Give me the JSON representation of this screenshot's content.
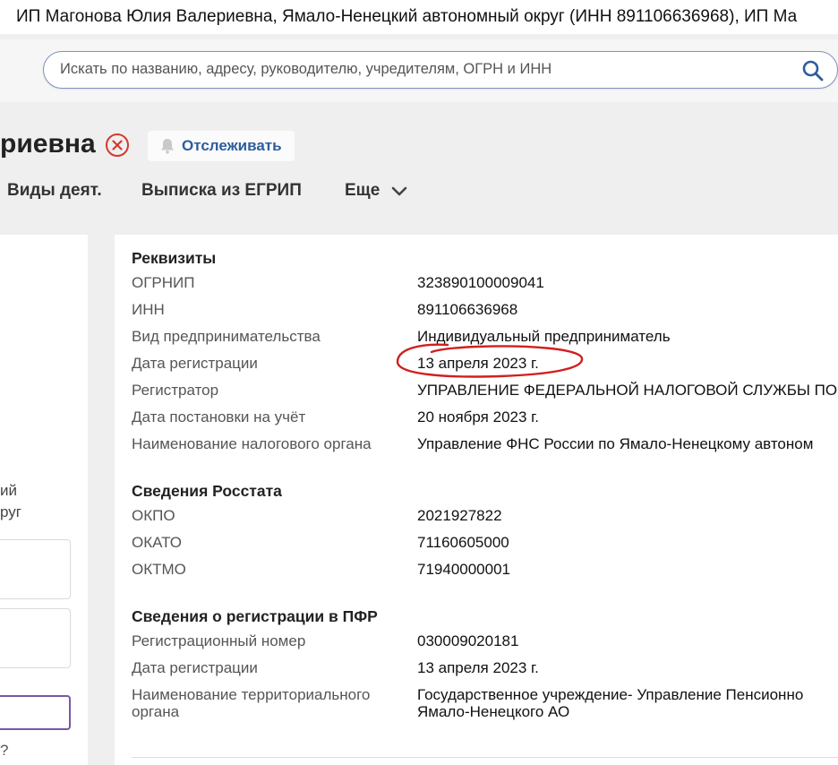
{
  "window": {
    "title": "ИП Магонова Юлия Валериевна, Ямало-Ненецкий автономный округ (ИНН 891106636968), ИП Ма"
  },
  "search": {
    "placeholder": "Искать по названию, адресу, руководителю, учредителям, ОГРН и ИНН",
    "icon": "search-icon"
  },
  "header": {
    "title": "риевна",
    "follow_label": "Отслеживать"
  },
  "tabs": [
    {
      "label": "Виды деят."
    },
    {
      "label": "Выписка из ЕГРИП"
    },
    {
      "label": "Еще"
    }
  ],
  "left_panel": {
    "line1": "ий",
    "line2": "руг",
    "question": "?"
  },
  "sections": [
    {
      "title": "Реквизиты",
      "rows": [
        {
          "label": "ОГРНИП",
          "value": "323890100009041"
        },
        {
          "label": "ИНН",
          "value": "891106636968"
        },
        {
          "label": "Вид предпринимательства",
          "value": "Индивидуальный предприниматель"
        },
        {
          "label": "Дата регистрации",
          "value": "13 апреля 2023 г."
        },
        {
          "label": "Регистратор",
          "value": "УПРАВЛЕНИЕ ФЕДЕРАЛЬНОЙ НАЛОГОВОЙ СЛУЖБЫ ПО"
        },
        {
          "label": "Дата постановки на учёт",
          "value": "20 ноября 2023 г."
        },
        {
          "label": "Наименование налогового органа",
          "value": "Управление ФНС России по Ямало-Ненецкому автоном"
        }
      ]
    },
    {
      "title": "Сведения Росстата",
      "rows": [
        {
          "label": "ОКПО",
          "value": "2021927822"
        },
        {
          "label": "ОКАТО",
          "value": "71160605000"
        },
        {
          "label": "ОКТМО",
          "value": "71940000001"
        }
      ]
    },
    {
      "title": "Сведения о регистрации в ПФР",
      "rows": [
        {
          "label": "Регистрационный номер",
          "value": "030009020181"
        },
        {
          "label": "Дата регистрации",
          "value": "13 апреля 2023 г."
        },
        {
          "label": "Наименование территориального",
          "label2": "органа",
          "value": "Государственное учреждение- Управление Пенсионно",
          "value2": "Ямало-Ненецкого АО"
        }
      ]
    }
  ],
  "colors": {
    "accent": "#2d5d9e",
    "close": "#d33a2c",
    "annotation": "#d21f1f",
    "highlight_border": "#7b55a8"
  }
}
